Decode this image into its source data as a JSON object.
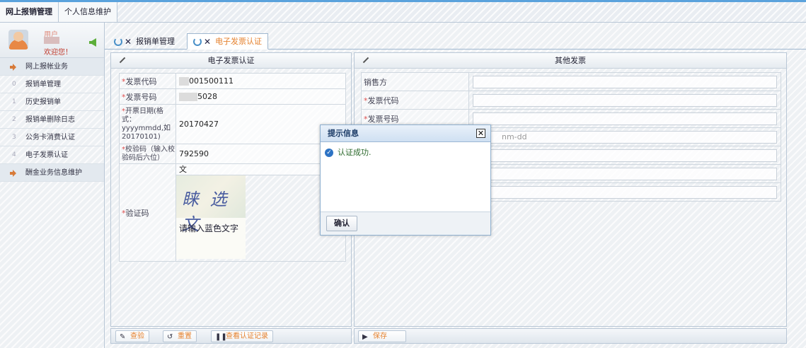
{
  "top_menu": [
    "网上报销管理",
    "个人信息维护"
  ],
  "user": {
    "name": "用户",
    "welcome": "欢迎您！"
  },
  "sidebar": {
    "items": [
      {
        "num": "",
        "label": "网上报帐业务",
        "group": true
      },
      {
        "num": "0",
        "label": "报销单管理"
      },
      {
        "num": "1",
        "label": "历史报销单"
      },
      {
        "num": "2",
        "label": "报销单删除日志"
      },
      {
        "num": "3",
        "label": "公务卡消费认证"
      },
      {
        "num": "4",
        "label": "电子发票认证"
      },
      {
        "num": "",
        "label": "酬金业务信息维护",
        "group": true
      }
    ]
  },
  "tabs": [
    {
      "label": "报销单管理",
      "active": false
    },
    {
      "label": "电子发票认证",
      "active": true
    }
  ],
  "left_panel": {
    "title": "电子发票认证",
    "fields": {
      "invoice_code_label": "*发票代码",
      "invoice_code_value": "001500111",
      "invoice_number_label": "*发票号码",
      "invoice_number_value": "5028",
      "date_label": "*开票日期(格式：yyyymmdd,如20170101)",
      "date_value": "20170427",
      "check_code_label": "*校验码（输入校验码后六位）",
      "check_code_value": "792590",
      "captcha_label": "*验证码",
      "captcha_input_value": "文",
      "captcha_chars": "睐 选 文",
      "captcha_hint": "请输入蓝色文字"
    },
    "toolbar": {
      "check_label": "查验",
      "reset_label": "重置",
      "record_label": "查看认证记录"
    }
  },
  "right_panel": {
    "title": "其他发票",
    "fields": {
      "seller_label": "销售方",
      "invoice_code_label": "*发票代码",
      "invoice_number_label": "*发票号码",
      "date_placeholder": "nm-dd"
    },
    "toolbar": {
      "save_label": "保存"
    }
  },
  "dialog": {
    "title": "提示信息",
    "message": "认证成功.",
    "ok_label": "确认"
  }
}
